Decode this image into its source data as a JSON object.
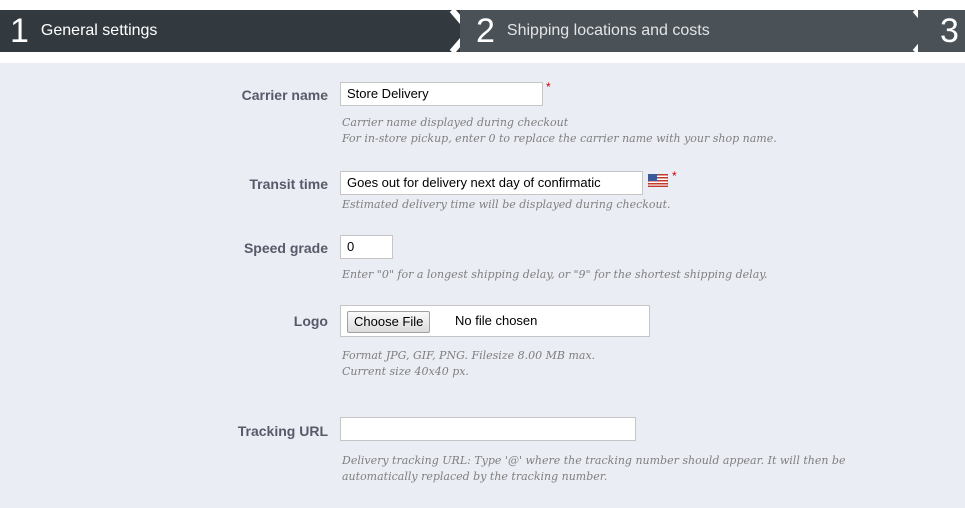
{
  "steps": [
    {
      "number": "1",
      "label": "General settings"
    },
    {
      "number": "2",
      "label": "Shipping locations and costs"
    },
    {
      "number": "3",
      "label": ""
    }
  ],
  "form": {
    "carrier_name": {
      "label": "Carrier name",
      "value": "Store Delivery",
      "required_mark": "*",
      "hint_line1": "Carrier name displayed during checkout",
      "hint_line2": "For in-store pickup, enter 0 to replace the carrier name with your shop name."
    },
    "transit_time": {
      "label": "Transit time",
      "value": "Goes out for delivery next day of confirmatic",
      "required_mark": "*",
      "language_flag": "us-flag-icon",
      "hint": "Estimated delivery time will be displayed during checkout."
    },
    "speed_grade": {
      "label": "Speed grade",
      "value": "0",
      "hint": "Enter \"0\" for a longest shipping delay, or \"9\" for the shortest shipping delay."
    },
    "logo": {
      "label": "Logo",
      "button_label": "Choose File",
      "file_status": "No file chosen",
      "hint_line1": "Format JPG, GIF, PNG. Filesize 8.00 MB max.",
      "hint_line2": "Current size 40x40 px."
    },
    "tracking_url": {
      "label": "Tracking URL",
      "value": "",
      "hint_line1": "Delivery tracking URL: Type '@' where the tracking number should appear. It will then be",
      "hint_line2": "automatically replaced by the tracking number."
    }
  },
  "colors": {
    "step_active": "#333a3f",
    "step_inactive": "#4b5257",
    "panel_bg": "#ebedf4",
    "label": "#585a69",
    "hint": "#7f7f7f",
    "required": "#cc0000"
  }
}
